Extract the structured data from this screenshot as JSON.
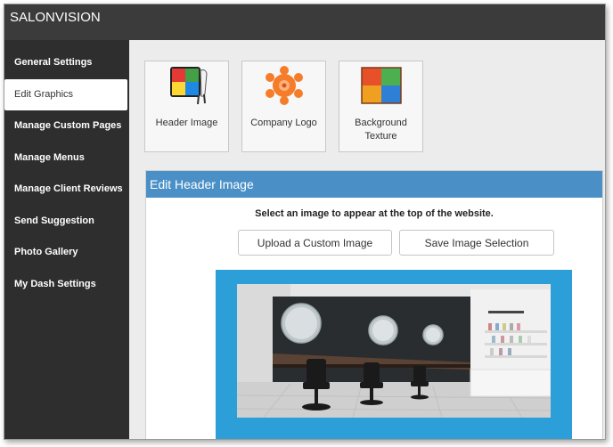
{
  "app": {
    "title": "SALONVISION"
  },
  "sidebar": {
    "items": [
      {
        "label": "General Settings",
        "active": false
      },
      {
        "label": "Edit Graphics",
        "active": true
      },
      {
        "label": "Manage Custom Pages",
        "active": false
      },
      {
        "label": "Manage Menus",
        "active": false
      },
      {
        "label": "Manage Client Reviews",
        "active": false
      },
      {
        "label": "Send Suggestion",
        "active": false
      },
      {
        "label": "Photo Gallery",
        "active": false
      },
      {
        "label": "My Dash Settings",
        "active": false
      }
    ]
  },
  "tiles": [
    {
      "label": "Header Image",
      "icon": "header-image-icon"
    },
    {
      "label": "Company Logo",
      "icon": "company-logo-icon"
    },
    {
      "label_line1": "Background",
      "label_line2": "Texture",
      "icon": "background-texture-icon"
    }
  ],
  "panel": {
    "title": "Edit Header Image",
    "instruction": "Select an image to appear at the top of the website.",
    "upload_label": "Upload a Custom Image",
    "save_label": "Save Image Selection"
  },
  "colors": {
    "topbar": "#3b3b3b",
    "sidebar": "#2e2e2e",
    "panel_header": "#4a90c7",
    "preview_frame": "#2c9fd8"
  }
}
